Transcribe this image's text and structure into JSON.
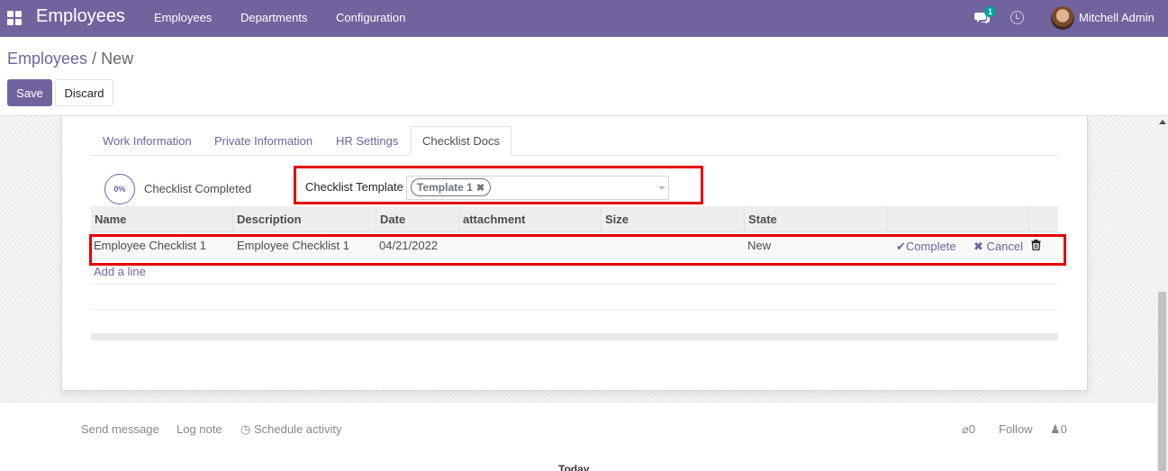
{
  "navbar": {
    "app_name": "Employees",
    "menu": [
      "Employees",
      "Departments",
      "Configuration"
    ],
    "chat_badge": "1",
    "user_name": "Mitchell Admin",
    "color": "#71639e"
  },
  "breadcrumb": {
    "parent": "Employees",
    "separator": "/",
    "current": "New"
  },
  "buttons": {
    "save": "Save",
    "discard": "Discard"
  },
  "tabs": [
    "Work Information",
    "Private Information",
    "HR Settings",
    "Checklist Docs"
  ],
  "active_tab": "Checklist Docs",
  "progress": {
    "value": "0%",
    "label": "Checklist Completed"
  },
  "checklist_template": {
    "label": "Checklist Template",
    "tag": "Template 1"
  },
  "table": {
    "columns": [
      "Name",
      "Description",
      "Date",
      "attachment",
      "Size",
      "State"
    ],
    "rows": [
      {
        "name": "Employee Checklist 1",
        "description": "Employee Checklist 1",
        "date": "04/21/2022",
        "attachment": "",
        "size": "",
        "state": "New",
        "complete_label": "Complete",
        "cancel_label": "Cancel"
      }
    ],
    "add_line": "Add a line"
  },
  "chatter": {
    "send_message": "Send message",
    "log_note": "Log note",
    "schedule_activity": "Schedule activity",
    "attachments_count": "0",
    "follow": "Follow",
    "followers_count": "0",
    "today": "Today"
  },
  "colors": {
    "brand": "#71639e",
    "highlight": "#e60000"
  }
}
